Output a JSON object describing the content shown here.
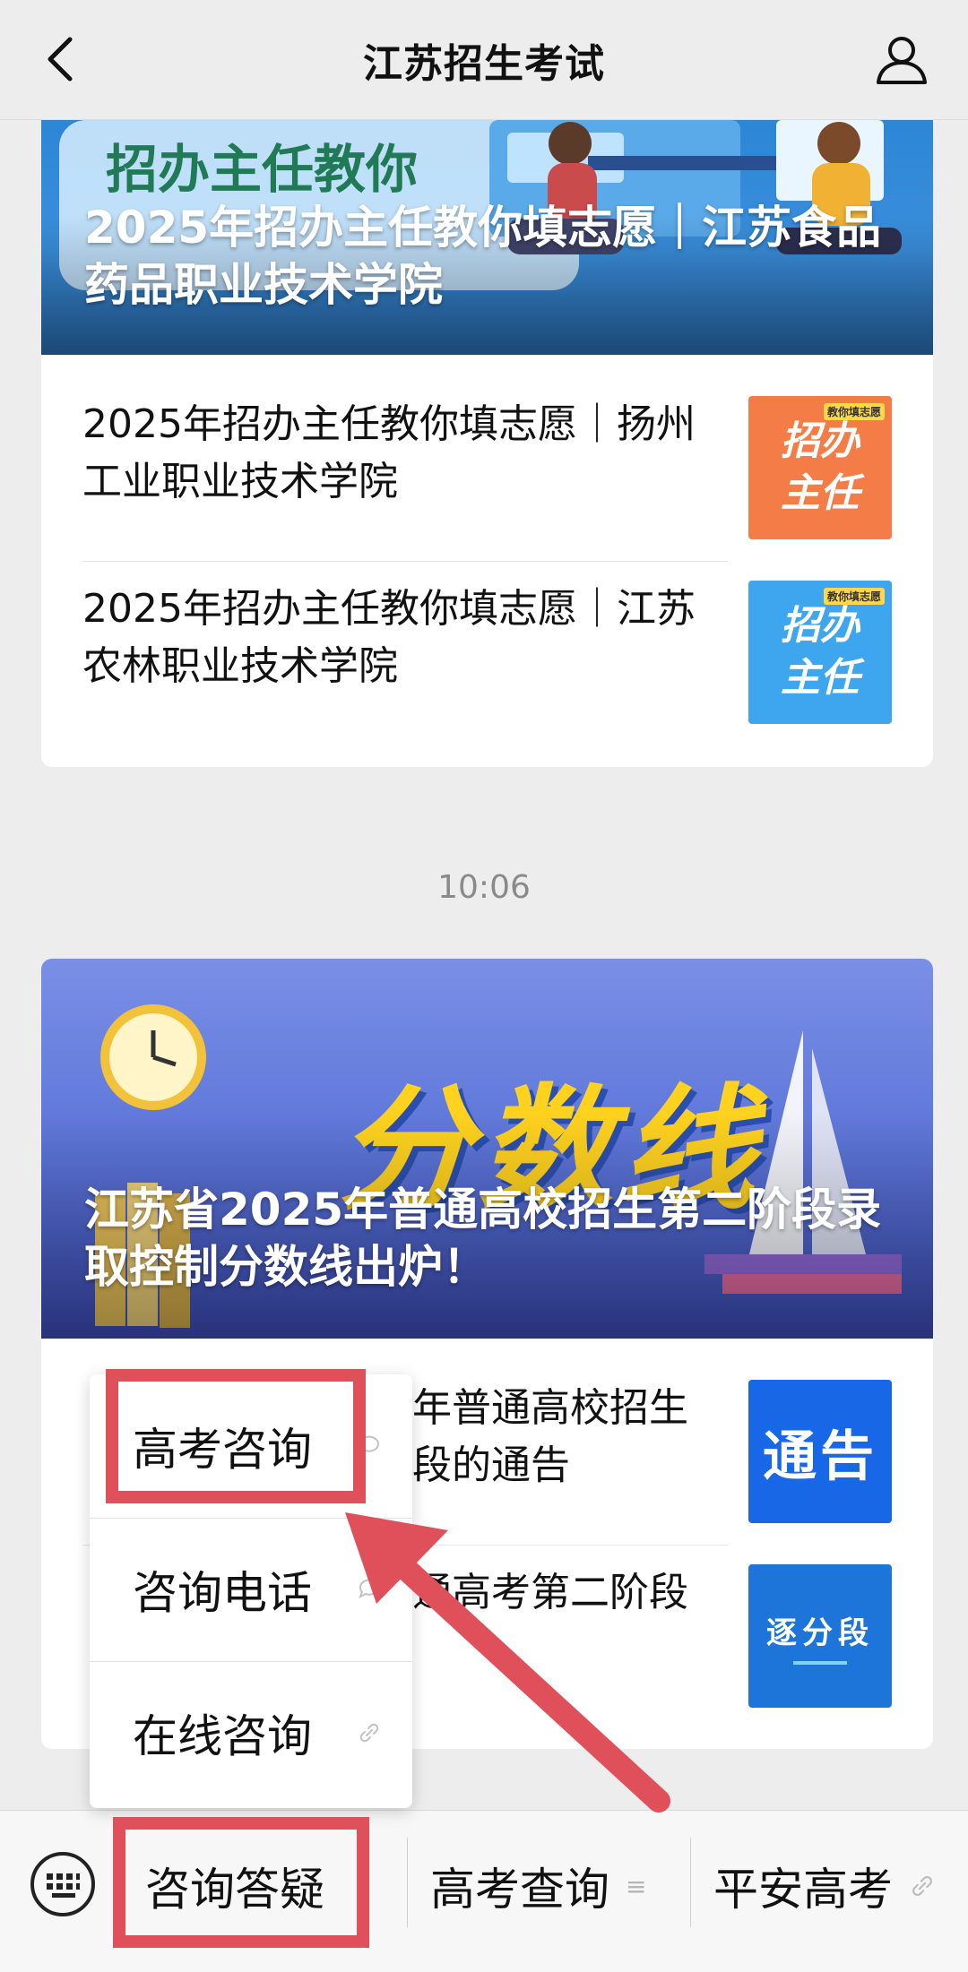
{
  "header": {
    "title": "江苏招生考试",
    "back_icon": "back-arrow-icon",
    "user_icon": "user-profile-icon"
  },
  "card1": {
    "banner": {
      "deco_text": "招办主任教你",
      "caption": "2025年招办主任教你填志愿｜江苏食品药品职业技术学院"
    },
    "items": [
      {
        "title": "2025年招办主任教你填志愿｜扬州工业职业技术学院",
        "thumb_text": [
          "招办",
          "主任"
        ],
        "thumb_badge": "教你填志愿"
      },
      {
        "title": "2025年招办主任教你填志愿｜江苏农林职业技术学院",
        "thumb_text": [
          "招办",
          "主任"
        ],
        "thumb_badge": "教你填志愿"
      }
    ]
  },
  "timestamp": "10:06",
  "card2": {
    "banner": {
      "deco_text": "分数线",
      "caption": "江苏省2025年普通高校招生第二阶段录取控制分数线出炉！"
    },
    "items": [
      {
        "title_visible": "年普通高校招生\n段的通告",
        "thumb_text": "通告"
      },
      {
        "title_visible": "通高考第二阶段",
        "thumb_text": "逐分段"
      }
    ]
  },
  "popup_menu": {
    "items": [
      {
        "label": "高考咨询",
        "icon": "chat-icon"
      },
      {
        "label": "咨询电话",
        "icon": "chat-icon"
      },
      {
        "label": "在线咨询",
        "icon": "link-icon"
      }
    ]
  },
  "bottom_menu": {
    "keyboard_icon": "keyboard-icon",
    "items": [
      {
        "label": "咨询答疑",
        "icon": ""
      },
      {
        "label": "高考查询",
        "icon": "menu-lines-icon"
      },
      {
        "label": "平安高考",
        "icon": "link-icon"
      }
    ]
  },
  "colors": {
    "annotation_red": "#e0505a",
    "background": "#ededed"
  }
}
